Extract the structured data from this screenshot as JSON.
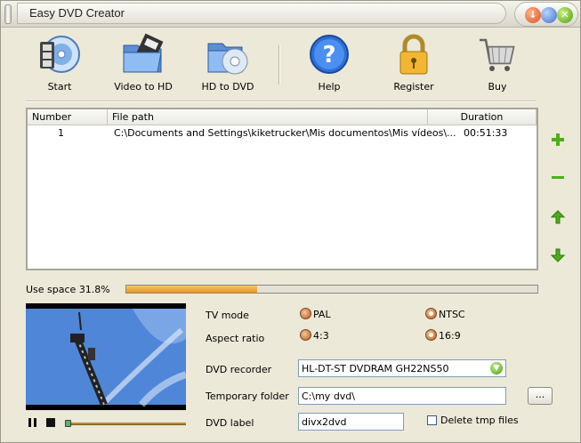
{
  "window": {
    "title": "Easy DVD Creator"
  },
  "toolbar": {
    "start": "Start",
    "video_to_hd": "Video to HD",
    "hd_to_dvd": "HD to DVD",
    "help": "Help",
    "register": "Register",
    "buy": "Buy"
  },
  "table": {
    "columns": [
      "Number",
      "File path",
      "Duration"
    ],
    "rows": [
      {
        "number": "1",
        "path": "C:\\Documents and Settings\\kiketrucker\\Mis documentos\\Mis vídeos\\...",
        "duration": "00:51:33"
      }
    ]
  },
  "usage": {
    "label": "Use space 31.8%",
    "fraction": 0.318
  },
  "form": {
    "tv_mode_label": "TV mode",
    "pal": "PAL",
    "ntsc": "NTSC",
    "aspect_label": "Aspect ratio",
    "ar_43": "4:3",
    "ar_169": "16:9",
    "recorder_label": "DVD recorder",
    "recorder_value": "HL-DT-ST DVDRAM GH22NS50",
    "temp_label": "Temporary folder",
    "temp_value": "C:\\my dvd\\",
    "browse": "...",
    "dvd_label_label": "DVD label",
    "dvd_label_value": "divx2dvd",
    "delete_tmp": "Delete tmp files"
  }
}
